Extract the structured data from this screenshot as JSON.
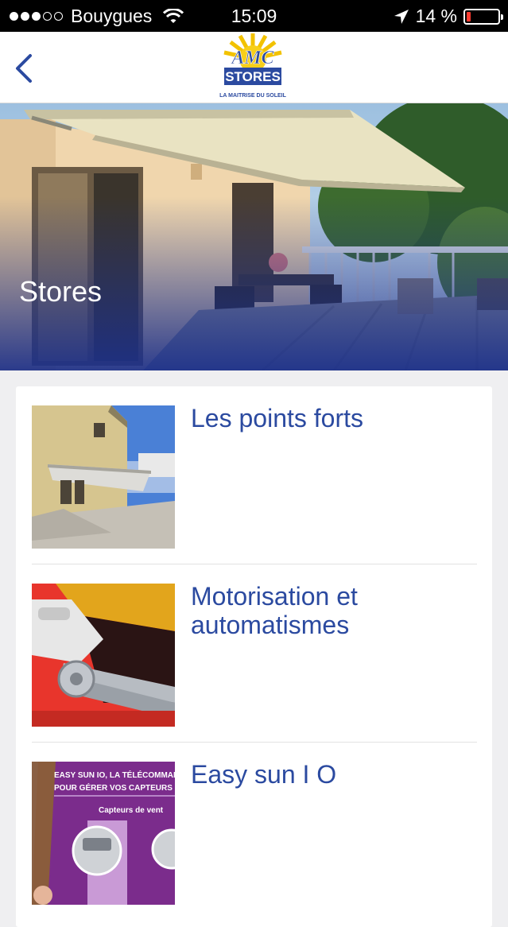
{
  "status_bar": {
    "carrier": "Bouygues",
    "time": "15:09",
    "battery": "14 %",
    "battery_level": 0.14
  },
  "nav": {
    "logo_name": "AMC",
    "logo_stores": "STORES",
    "logo_tagline": "LA MAITRISE DU SOLEIL"
  },
  "hero": {
    "title": "Stores"
  },
  "items": [
    {
      "label": "Les points forts"
    },
    {
      "label": "Motorisation et automatismes"
    },
    {
      "label": "Easy sun I O",
      "thumb_line1": "EASY SUN IO, LA TÉLÉCOMMAN",
      "thumb_line2": "POUR GÉRER VOS CAPTEURS",
      "thumb_line3": "Capteurs de vent"
    }
  ],
  "colors": {
    "accent": "#2b4aa0",
    "status_bg": "#000000",
    "background": "#efeff1"
  }
}
